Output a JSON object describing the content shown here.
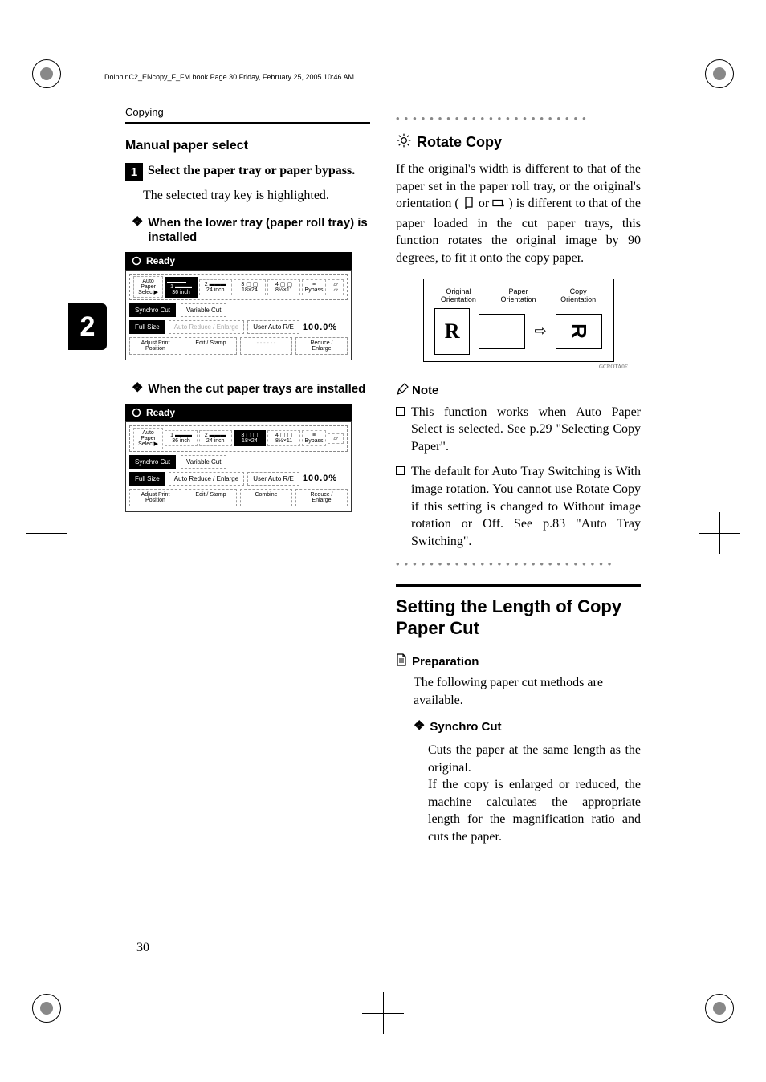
{
  "book_header": "DolphinC2_ENcopy_F_FM.book  Page 30  Friday, February 25, 2005  10:46 AM",
  "running_head": "Copying",
  "tab_number": "2",
  "page_number": "30",
  "left": {
    "section_title": "Manual paper select",
    "step1_num": "1",
    "step1_text": "Select the paper tray or paper bypass.",
    "step1_body": "The selected tray key is highlighted.",
    "sub1": "When the lower tray (paper roll tray) is installed",
    "sub2": "When the cut paper trays are installed",
    "ready": "Ready",
    "screenshot_common": {
      "auto_paper": "Auto Paper",
      "select": "Select",
      "bypass": "Bypass",
      "synchro": "Synchro Cut",
      "variable": "Variable Cut",
      "full_size": "Full Size",
      "auto_re": "Auto Reduce / Enlarge",
      "user_re": "User Auto R/E",
      "pct": "100.0%",
      "adjust": "Adjust Print Position",
      "edit": "Edit / Stamp",
      "combine": "Combine",
      "reduce": "Reduce / Enlarge"
    },
    "screenshot1": {
      "tray1": "36 inch",
      "tray2": "24 inch",
      "tray3": "18×24",
      "tray4": "8½×11",
      "combine_disabled": "- - - - - -"
    },
    "screenshot2": {
      "tray1": "36 inch",
      "tray2": "24 inch",
      "tray3": "18×24",
      "tray4": "8½×11",
      "combine": "Combine"
    }
  },
  "right": {
    "rotate_title": "Rotate Copy",
    "rotate_body_pre": "If the original's width is different to that of the paper set in the paper roll tray, or the original's orientation ( ",
    "rotate_body_mid": " or ",
    "rotate_body_post": " ) is different to that of the paper loaded in the cut paper trays, this function rotates the original image by 90 degrees, to fit it onto the copy paper.",
    "diagram": {
      "label1": "Original\nOrientation",
      "label2": "Paper\nOrientation",
      "label3": "Copy\nOrientation",
      "glyph": "R",
      "caption": "GCROTA0E"
    },
    "note_label": "Note",
    "note1": "This function works when Auto Paper Select is selected. See p.29 \"Selecting Copy Paper\".",
    "note2": "The default for Auto Tray Switching is With image rotation. You cannot use Rotate Copy if this setting is changed to Without image rotation or Off. See p.83 \"Auto Tray Switching\".",
    "h1": "Setting the Length of Copy Paper Cut",
    "prep_label": "Preparation",
    "prep_body": "The following paper cut methods are available.",
    "synchro_label": "Synchro Cut",
    "synchro_body": "Cuts the paper at the same length as the original.\nIf the copy is enlarged or reduced, the machine calculates the appropriate length for the magnification ratio and cuts the paper."
  }
}
